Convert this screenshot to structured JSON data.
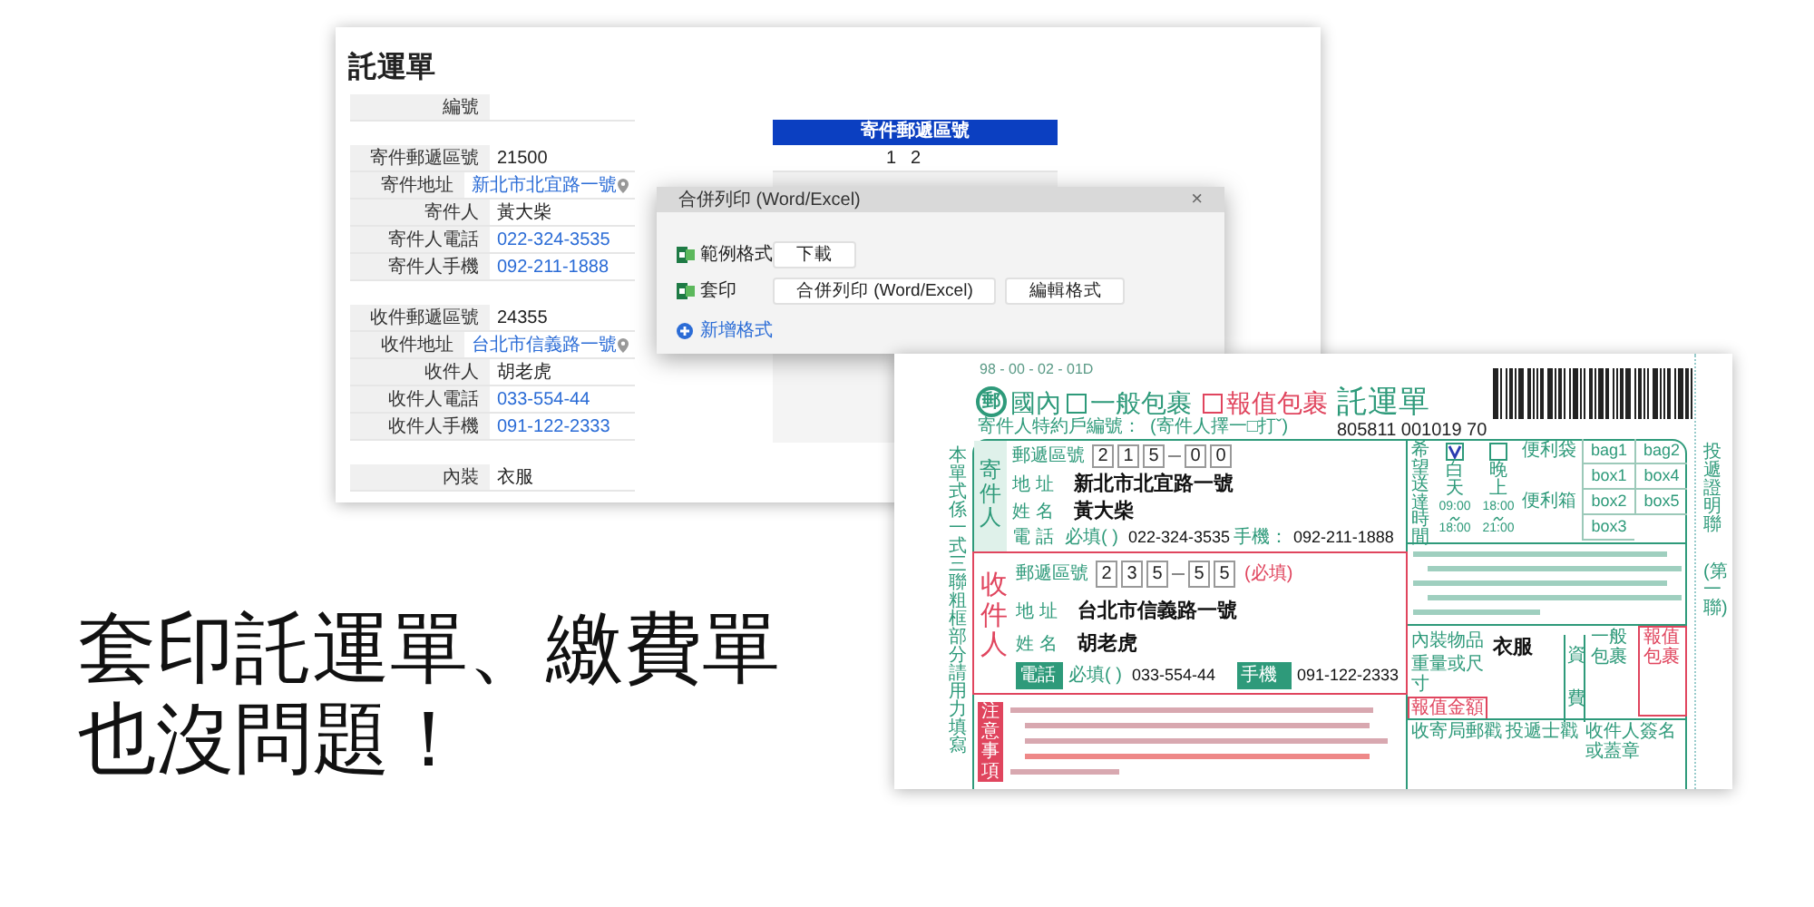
{
  "app_window": {
    "title": "託運單",
    "field_groups": [
      [
        {
          "label": "編號"
        }
      ],
      [
        {
          "label": "寄件郵遞區號",
          "value": "21500",
          "kind": "text"
        },
        {
          "label": "寄件地址",
          "value": "新北市北宜路一號",
          "kind": "address"
        },
        {
          "label": "寄件人",
          "value": "黃大柴",
          "kind": "text"
        },
        {
          "label": "寄件人電話",
          "value": "022-324-3535",
          "kind": "link"
        },
        {
          "label": "寄件人手機",
          "value": "092-211-1888",
          "kind": "link"
        }
      ],
      [
        {
          "label": "收件郵遞區號",
          "value": "24355",
          "kind": "text"
        },
        {
          "label": "收件地址",
          "value": "台北市信義路一號",
          "kind": "address"
        },
        {
          "label": "收件人",
          "value": "胡老虎",
          "kind": "text"
        },
        {
          "label": "收件人電話",
          "value": "033-554-44",
          "kind": "link"
        },
        {
          "label": "收件人手機",
          "value": "091-122-2333",
          "kind": "link"
        }
      ],
      [
        {
          "label": "內裝",
          "value": "衣服",
          "kind": "text"
        }
      ]
    ],
    "side_table": {
      "columns": [
        "寄件郵遞區號"
      ],
      "rows": [
        {
          "index": "1",
          "value": "2"
        }
      ]
    }
  },
  "dialog": {
    "title": "合併列印 (Word/Excel)",
    "close": "×",
    "rows": [
      {
        "label": "範例格式",
        "buttons": [
          "下載"
        ]
      },
      {
        "label": "套印",
        "buttons": [
          "合併列印 (Word/Excel)",
          "編輯格式"
        ]
      }
    ],
    "add_link": "新增格式"
  },
  "form": {
    "form_code": "98 - 00 - 02 - 01D",
    "logo": "郵",
    "domestic": "國內",
    "options": [
      {
        "label": "一般包裹",
        "checked": false,
        "kind": "regular"
      },
      {
        "label": "報值包裹",
        "checked": false,
        "kind": "insured"
      }
    ],
    "form_title": "託運單",
    "option_hint": "(寄件人擇一□打ˇ)",
    "account_label": "寄件人特約戶編號：",
    "serial": "805811 001019 70",
    "side_note": "本單式係一式三聯粗框部分請用力填寫",
    "sender": {
      "title": "寄件人",
      "postal_label": "郵遞區號",
      "postal_digits": [
        "2",
        "1",
        "5",
        "0",
        "0"
      ],
      "address_label": "地 址",
      "address": "新北市北宜路一號",
      "name_label": "姓 名",
      "name": "黃大柴",
      "phone_label": "電 話",
      "phone_hint": "必填(  )",
      "phone": "022-324-3535",
      "mobile_label": "手機：",
      "mobile": "092-211-1888",
      "tagged": false
    },
    "receiver": {
      "title": "收件人",
      "postal_label": "郵遞區號",
      "postal_digits": [
        "2",
        "3",
        "5",
        "5",
        "5"
      ],
      "postal_note": "(必填)",
      "address_label": "地 址",
      "address": "台北市信義路一號",
      "name_label": "姓 名",
      "name": "胡老虎",
      "phone_label": "電話",
      "phone_hint": "必填(  )",
      "phone": "033-554-44",
      "mobile_label": "手機",
      "mobile": "091-122-2333",
      "tagged": true
    },
    "notes_title": "注意事項",
    "delivery_time": {
      "title": "希望送達時間",
      "slots": [
        {
          "label": "白天",
          "start": "09:00",
          "end": "18:00",
          "checked": true
        },
        {
          "label": "晚上",
          "start": "18:00",
          "end": "21:00",
          "checked": false
        }
      ]
    },
    "packaging": [
      {
        "label": "便利袋",
        "cells": [
          "bag1",
          "bag2"
        ]
      },
      {
        "cells": [
          "box1",
          "box4"
        ]
      },
      {
        "label": "便利箱",
        "cells": [
          "box2",
          "box5"
        ]
      },
      {
        "cells": [
          "box3"
        ]
      }
    ],
    "contents_label": "內裝物品",
    "contents": "衣服",
    "weight_label": "重量或尺寸",
    "insured_amount_label": "報值金額",
    "fee_label": "資費",
    "fee_columns": [
      "一般包裹",
      "報值包裹"
    ],
    "stamps": [
      "收寄局郵戳",
      "投遞士戳",
      "收件人簽名或蓋章"
    ],
    "copy_label": "投遞證明聯",
    "copy_number": "(第一聯)"
  },
  "headline": [
    "套印託運單、繳費單",
    "也沒問題！"
  ]
}
